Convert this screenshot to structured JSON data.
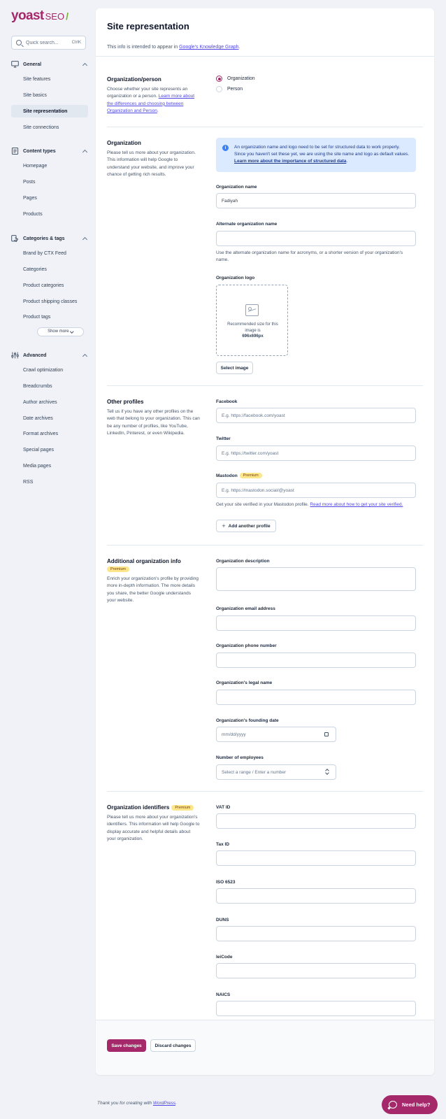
{
  "brand": {
    "name": "yoast",
    "product": "SEO",
    "slash": "/"
  },
  "search": {
    "placeholder": "Quick search...",
    "shortcut": "CtrlK"
  },
  "nav": {
    "general": {
      "label": "General",
      "items": [
        "Site features",
        "Site basics",
        "Site representation",
        "Site connections"
      ],
      "active": "Site representation"
    },
    "content_types": {
      "label": "Content types",
      "items": [
        "Homepage",
        "Posts",
        "Pages",
        "Products"
      ]
    },
    "categories": {
      "label": "Categories & tags",
      "items": [
        "Brand by CTX Feed",
        "Categories",
        "Product categories",
        "Product shipping classes",
        "Product tags"
      ],
      "show_more": "Show more"
    },
    "advanced": {
      "label": "Advanced",
      "items": [
        "Crawl optimization",
        "Breadcrumbs",
        "Author archives",
        "Date archives",
        "Format archives",
        "Special pages",
        "Media pages",
        "RSS"
      ]
    }
  },
  "page": {
    "title": "Site representation",
    "desc_prefix": "This info is intended to appear in ",
    "desc_link": "Google's Knowledge Graph",
    "desc_suffix": "."
  },
  "org_person": {
    "title": "Organization/person",
    "desc": "Choose whether your site represents an organization or a person. ",
    "desc_link": "Learn more about the differences and choosing between Organization and Person",
    "desc_suffix": ".",
    "options": [
      "Organization",
      "Person"
    ],
    "selected": "Organization"
  },
  "organization": {
    "title": "Organization",
    "desc": "Please tell us more about your organization. This information will help Google to understand your website, and improve your chance of getting rich results.",
    "alert": "An organization name and logo need to be set for structured data to work properly. Since you haven't set these yet, we are using the site name and logo as default values. ",
    "alert_link": "Learn more about the importance of structured data",
    "alert_suffix": ".",
    "name_label": "Organization name",
    "name_value": "Fadiyah",
    "alt_label": "Alternate organization name",
    "alt_value": "",
    "alt_help": "Use the alternate organization name for acronyms, or a shorter version of your organization's name.",
    "logo_label": "Organization logo",
    "logo_hint": "Recommended size for this image is",
    "logo_size": "696x696px",
    "select_image": "Select image"
  },
  "profiles": {
    "title": "Other profiles",
    "desc": "Tell us if you have any other profiles on the web that belong to your organization. This can be any number of profiles, like YouTube, LinkedIn, Pinterest, or even Wikipedia.",
    "facebook_label": "Facebook",
    "facebook_placeholder": "E.g. https://facebook.com/yoast",
    "twitter_label": "Twitter",
    "twitter_placeholder": "E.g. https://twitter.com/yoast",
    "mastodon_label": "Mastodon",
    "mastodon_placeholder": "E.g. https://mastodon.social/@yoast",
    "mastodon_help": "Get your site verified in your Mastodon profile. ",
    "mastodon_help_link": "Read more about how to get your site verified.",
    "add_profile": "Add another profile"
  },
  "premium": "Premium",
  "additional": {
    "title": "Additional organization info",
    "desc": "Enrich your organization's profile by providing more in-depth information. The more details you share, the better Google understands your website.",
    "description_label": "Organization description",
    "email_label": "Organization email address",
    "phone_label": "Organization phone number",
    "legal_label": "Organization's legal name",
    "founding_label": "Organization's founding date",
    "founding_placeholder": "mm/dd/yyyy",
    "employees_label": "Number of employees",
    "employees_placeholder": "Select a range / Enter a number"
  },
  "identifiers": {
    "title": "Organization identifiers",
    "desc": "Please tell us more about your organization's identifiers. This information will help Google to display accurate and helpful details about your organization.",
    "fields": [
      "VAT ID",
      "Tax ID",
      "ISO 6523",
      "DUNS",
      "leiCode",
      "NAICS"
    ]
  },
  "actions": {
    "save": "Save changes",
    "discard": "Discard changes"
  },
  "footer": {
    "text": "Thank you for creating with ",
    "link": "WordPress",
    "suffix": "."
  },
  "help_button": "Need help?",
  "colors": {
    "brand": "#a4286a",
    "accent_green": "#77b227",
    "alert_bg": "#dbeafe"
  }
}
